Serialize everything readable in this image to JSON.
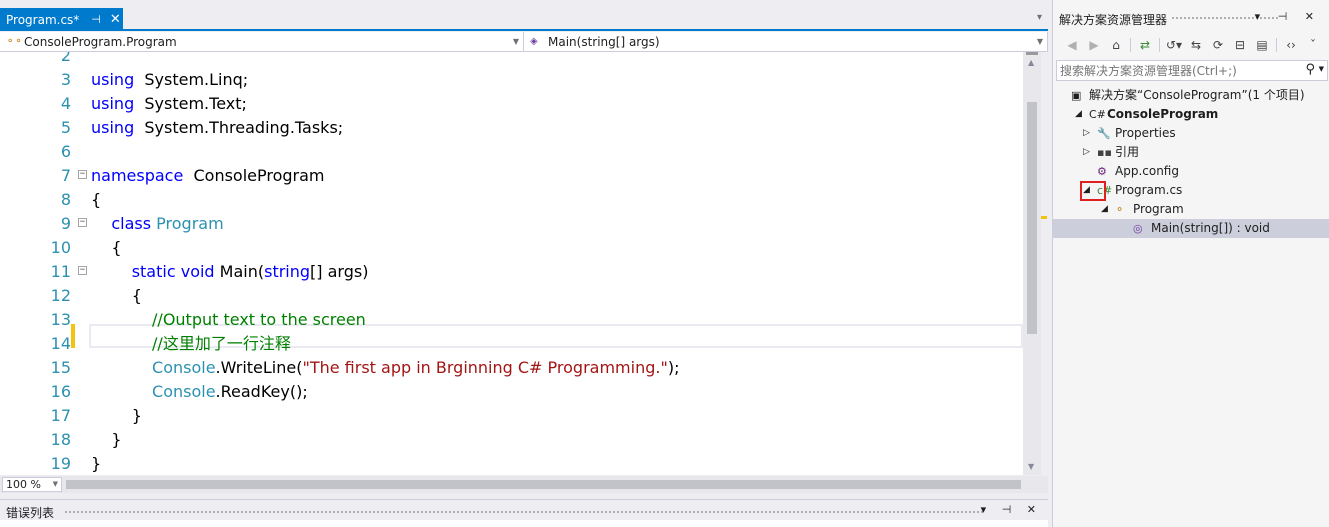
{
  "editor": {
    "tab": {
      "title": "Program.cs*",
      "pin": "⊣",
      "close": "✕"
    },
    "tab_overflow": "▾",
    "nav": {
      "type_combo": "ConsoleProgram.Program",
      "member_combo": "Main(string[] args)"
    },
    "lines": [
      {
        "n": "2",
        "fold": "",
        "tokens": []
      },
      {
        "n": "3",
        "fold": "",
        "tokens": [
          [
            "kw",
            "using"
          ],
          [
            "",
            "  System.Linq;"
          ]
        ]
      },
      {
        "n": "4",
        "fold": "",
        "tokens": [
          [
            "kw",
            "using"
          ],
          [
            "",
            "  System.Text;"
          ]
        ]
      },
      {
        "n": "5",
        "fold": "",
        "tokens": [
          [
            "kw",
            "using"
          ],
          [
            "",
            "  System.Threading.Tasks;"
          ]
        ]
      },
      {
        "n": "6",
        "fold": "",
        "tokens": []
      },
      {
        "n": "7",
        "fold": "−",
        "tokens": [
          [
            "kw",
            "namespace"
          ],
          [
            "",
            "  ConsoleProgram"
          ]
        ]
      },
      {
        "n": "8",
        "fold": "",
        "tokens": [
          [
            "",
            "{"
          ]
        ]
      },
      {
        "n": "9",
        "fold": "−",
        "tokens": [
          [
            "",
            "    "
          ],
          [
            "kw",
            "class"
          ],
          [
            "",
            " "
          ],
          [
            "ty",
            "Program"
          ]
        ]
      },
      {
        "n": "10",
        "fold": "",
        "tokens": [
          [
            "",
            "    {"
          ]
        ]
      },
      {
        "n": "11",
        "fold": "−",
        "tokens": [
          [
            "",
            "        "
          ],
          [
            "kw",
            "static"
          ],
          [
            "",
            " "
          ],
          [
            "kw",
            "void"
          ],
          [
            "",
            " Main("
          ],
          [
            "kw",
            "string"
          ],
          [
            "",
            "[] args)"
          ]
        ]
      },
      {
        "n": "12",
        "fold": "",
        "tokens": [
          [
            "",
            "        {"
          ]
        ]
      },
      {
        "n": "13",
        "fold": "",
        "tokens": [
          [
            "",
            "            "
          ],
          [
            "cm",
            "//Output text to the screen"
          ]
        ]
      },
      {
        "n": "14",
        "fold": "",
        "tokens": [
          [
            "",
            "            "
          ],
          [
            "cm",
            "//这里加了一行注释"
          ]
        ]
      },
      {
        "n": "15",
        "fold": "",
        "tokens": [
          [
            "",
            "            "
          ],
          [
            "ty",
            "Console"
          ],
          [
            "",
            ".WriteLine("
          ],
          [
            "st",
            "\"The first app in Brginning C# Programming.\""
          ],
          [
            "",
            ");"
          ]
        ]
      },
      {
        "n": "16",
        "fold": "",
        "tokens": [
          [
            "",
            "            "
          ],
          [
            "ty",
            "Console"
          ],
          [
            "",
            ".ReadKey();"
          ]
        ]
      },
      {
        "n": "17",
        "fold": "",
        "tokens": [
          [
            "",
            "        }"
          ]
        ]
      },
      {
        "n": "18",
        "fold": "",
        "tokens": [
          [
            "",
            "    }"
          ]
        ]
      },
      {
        "n": "19",
        "fold": "",
        "tokens": [
          [
            "",
            "}"
          ]
        ]
      }
    ],
    "zoom": "100 %"
  },
  "error_panel": {
    "title": "错误列表",
    "controls": "▾ ⊣ ✕"
  },
  "solution_explorer": {
    "title": "解决方案资源管理器",
    "controls": "▾ ⊣ ✕",
    "search_placeholder": "搜索解决方案资源管理器(Ctrl+;)",
    "tree": [
      {
        "exp": "",
        "icon": "▣",
        "label": "解决方案“ConsoleProgram”(1 个项目)",
        "bold": false,
        "selected": false
      },
      {
        "exp": "◢",
        "icon": "C#",
        "label": "ConsoleProgram",
        "bold": true,
        "selected": false
      },
      {
        "exp": "▷",
        "icon": "🔧",
        "label": "Properties",
        "bold": false,
        "selected": false
      },
      {
        "exp": "▷",
        "icon": "▪▪",
        "label": "引用",
        "bold": false,
        "selected": false
      },
      {
        "exp": "",
        "icon": "⚙",
        "label": "App.config",
        "bold": false,
        "selected": false
      },
      {
        "exp": "◢",
        "icon": "c#",
        "label": "Program.cs",
        "bold": false,
        "selected": false
      },
      {
        "exp": "◢",
        "icon": "⚬",
        "label": "Program",
        "bold": false,
        "selected": false
      },
      {
        "exp": "",
        "icon": "◎",
        "label": "Main(string[]) : void",
        "bold": false,
        "selected": true
      }
    ]
  },
  "colors": {
    "accent": "#007acc",
    "keyword": "#0000ff",
    "type": "#2b91af",
    "comment": "#008000",
    "string": "#a31515",
    "highlight_box": "#e02020"
  }
}
